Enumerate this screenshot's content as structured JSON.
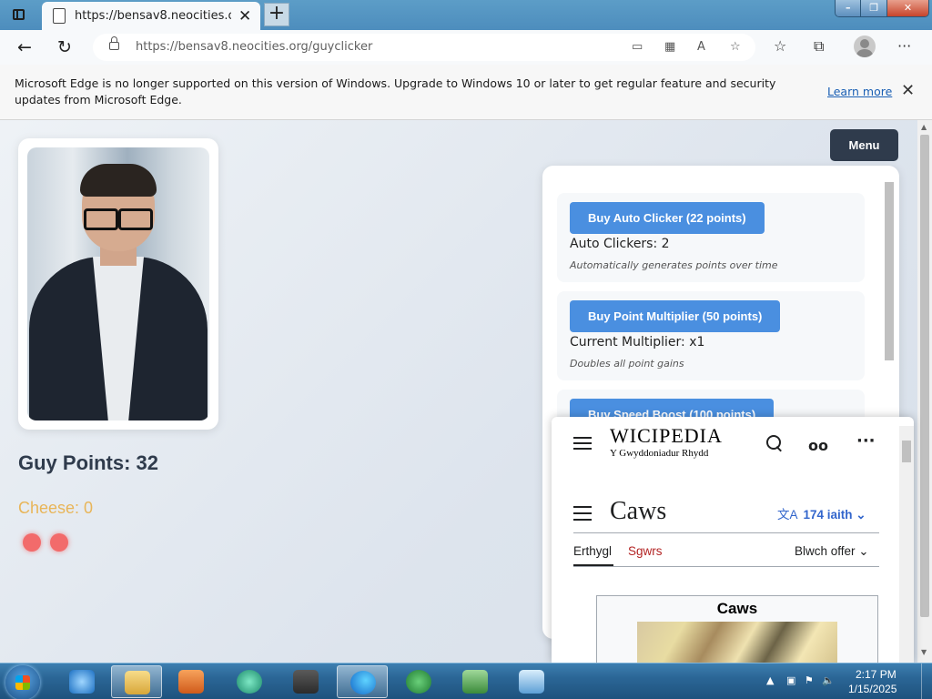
{
  "browser": {
    "tab_title": "https://bensav8.neocities.org/gu",
    "url": "https://bensav8.neocities.org/guyclicker",
    "tab_close": "✕",
    "new_tab": "+",
    "window_buttons": {
      "min": "–",
      "max": "❐",
      "close": "✕"
    },
    "nav": {
      "back": "←",
      "refresh": "↻"
    },
    "menu_glyph": "···"
  },
  "infobar": {
    "message": "Microsoft Edge is no longer supported on this version of Windows. Upgrade to Windows 10 or later to get regular feature and security updates from Microsoft Edge.",
    "learn_more": "Learn more",
    "close": "✕"
  },
  "game": {
    "points_label": "Guy Points: 32",
    "cheese_label": "Cheese: 0",
    "menu_label": "Menu",
    "shop": [
      {
        "button": "Buy Auto Clicker (22 points)",
        "status": "Auto Clickers: 2",
        "description": "Automatically generates points over time"
      },
      {
        "button": "Buy Point Multiplier (50 points)",
        "status": "Current Multiplier: x1",
        "description": "Doubles all point gains"
      },
      {
        "button": "Buy Speed Boost (100 points)"
      }
    ]
  },
  "wiki": {
    "logo": "WICIPEDIA",
    "tagline": "Y Gwyddoniadur Rhydd",
    "title": "Caws",
    "languages": "174 iaith",
    "tab_article": "Erthygl",
    "tab_talk": "Sgwrs",
    "tools": "Blwch offer",
    "infobox_title": "Caws"
  },
  "taskbar": {
    "time": "2:17 PM",
    "date": "1/15/2025"
  },
  "colors": {
    "accent_button": "#4a8fe0",
    "dark_button": "#2f3b4c",
    "cheese": "#e8b559",
    "wiki_link": "#3366cc",
    "wiki_red_link": "#b32424"
  }
}
